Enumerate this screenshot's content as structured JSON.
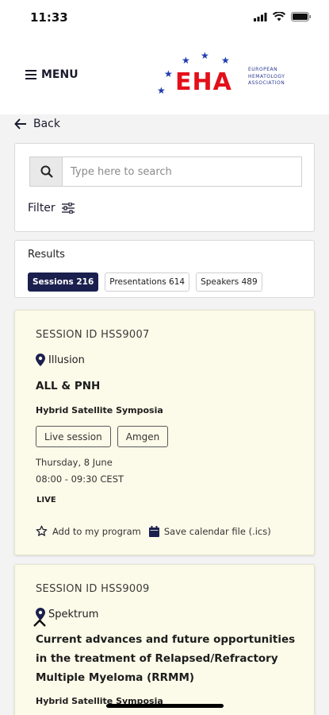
{
  "status": {
    "time": "11:33"
  },
  "header": {
    "menu_label": "MENU",
    "logo_text": "EHA",
    "logo_line1": "EUROPEAN",
    "logo_line2": "HEMATOLOGY",
    "logo_line3": "ASSOCIATION"
  },
  "nav": {
    "back_label": "Back"
  },
  "search": {
    "placeholder": "Type here to search",
    "value": ""
  },
  "filter": {
    "label": "Filter"
  },
  "results": {
    "label": "Results",
    "tabs": [
      {
        "label": "Sessions 216",
        "active": true
      },
      {
        "label": "Presentations 614",
        "active": false
      },
      {
        "label": "Speakers 489",
        "active": false
      }
    ]
  },
  "sessions": [
    {
      "id": "SESSION ID HSS9007",
      "location": "Illusion",
      "title": "ALL & PNH",
      "type": "Hybrid Satellite Symposia",
      "tags": [
        "Live session",
        "Amgen"
      ],
      "date": "Thursday, 8 June",
      "time": "08:00 - 09:30 CEST",
      "live": "LIVE",
      "add_label": "Add to my program",
      "calendar_label": "Save calendar file (.ics)"
    },
    {
      "id": "SESSION ID HSS9009",
      "location": "Spektrum",
      "title": "Current advances and future opportunities in the treatment of Relapsed/Refractory Multiple Myeloma (RRMM)",
      "type": "Hybrid Satellite Symposia"
    }
  ],
  "colors": {
    "brand_navy": "#1a1f4e",
    "eha_red": "#e3101a",
    "eha_blue": "#1d3caf",
    "card_bg": "#fcfbe9"
  }
}
